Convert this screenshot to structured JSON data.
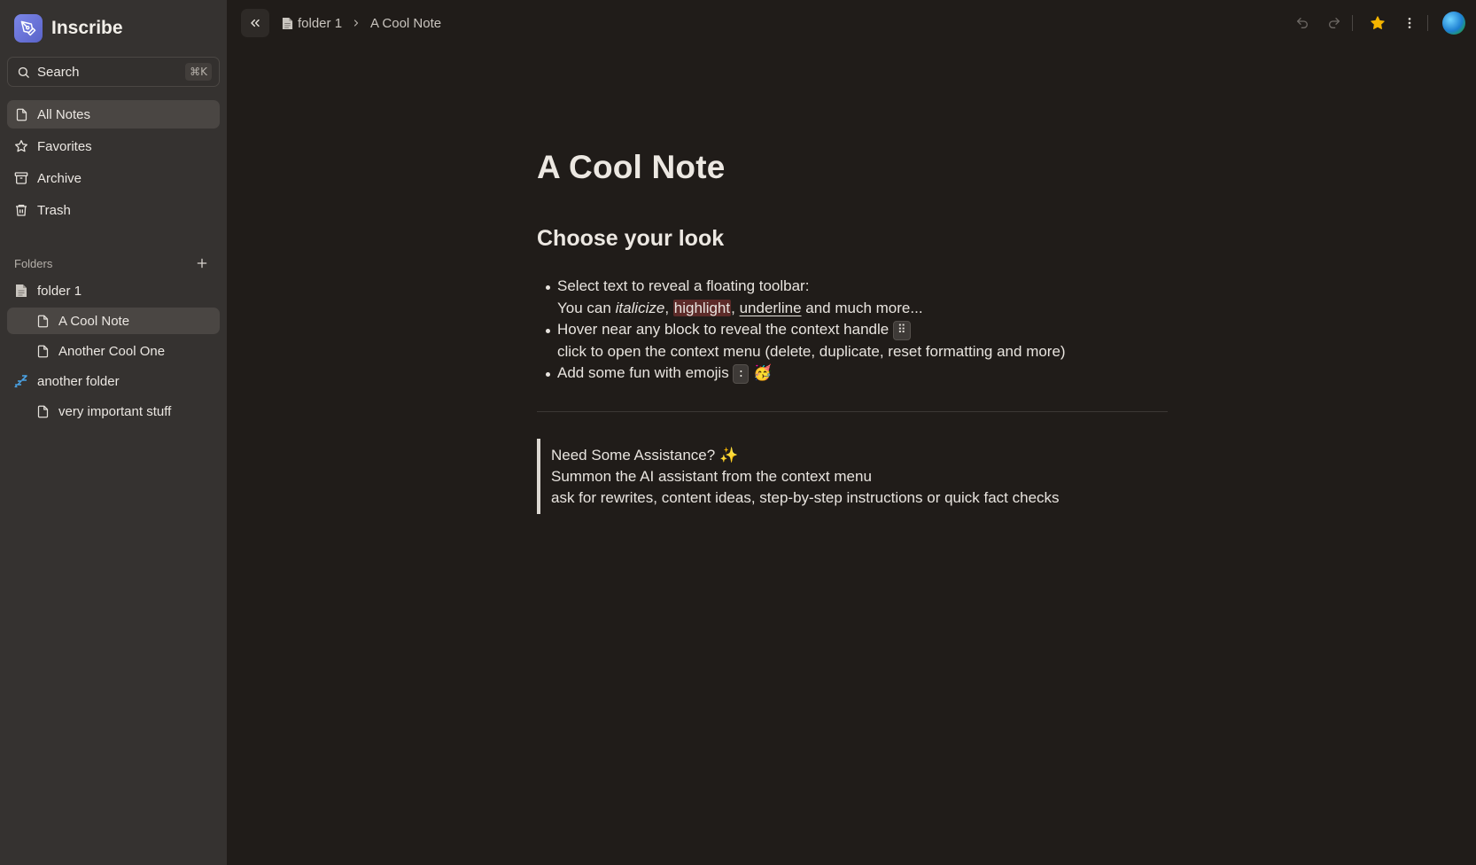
{
  "app": {
    "name": "Inscribe"
  },
  "search": {
    "label": "Search",
    "shortcut": "⌘K"
  },
  "nav": {
    "items": [
      {
        "label": "All Notes",
        "icon": "file-icon"
      },
      {
        "label": "Favorites",
        "icon": "star-icon"
      },
      {
        "label": "Archive",
        "icon": "archive-icon"
      },
      {
        "label": "Trash",
        "icon": "trash-icon"
      }
    ]
  },
  "folders": {
    "title": "Folders",
    "tree": [
      {
        "label": "folder 1",
        "icon": "page-icon"
      },
      {
        "label": "A Cool Note",
        "icon": "file-icon"
      },
      {
        "label": "Another Cool One",
        "icon": "file-icon"
      },
      {
        "label": "another folder",
        "icon": "zzz-emoji-icon"
      },
      {
        "label": "very important stuff",
        "icon": "file-icon"
      }
    ]
  },
  "breadcrumb": {
    "folder": "folder 1",
    "note": "A Cool Note"
  },
  "doc": {
    "title": "A Cool Note",
    "heading": "Choose your look",
    "b1_line1": "Select text to reveal a floating toolbar:",
    "b1_you_can": "You can",
    "b1_italic": "italicize",
    "b1_comma1": ",",
    "b1_highlight": "highlight",
    "b1_comma2": ",",
    "b1_underline": "underline",
    "b1_rest": "and much more...",
    "b2_line1": "Hover near any block to reveal the context handle",
    "b2_handle": "⠿",
    "b2_line2": "click to open the context menu (delete, duplicate, reset formatting and more)",
    "b3_text": "Add some fun with emojis",
    "b3_key": ":",
    "b3_emoji": "🥳",
    "callout_line1": "Need Some Assistance?",
    "callout_emoji": "✨",
    "callout_line2": "Summon the AI assistant from the context menu",
    "callout_line3": "ask for rewrites, content ideas, step-by-step instructions or quick fact checks"
  },
  "colors": {
    "sidebar_bg": "#353230",
    "main_bg": "#201c19",
    "active_item": "#4a4643",
    "favorite_star": "#f4b400",
    "highlight": "#5d2b29",
    "logo": "#6b74d8"
  }
}
